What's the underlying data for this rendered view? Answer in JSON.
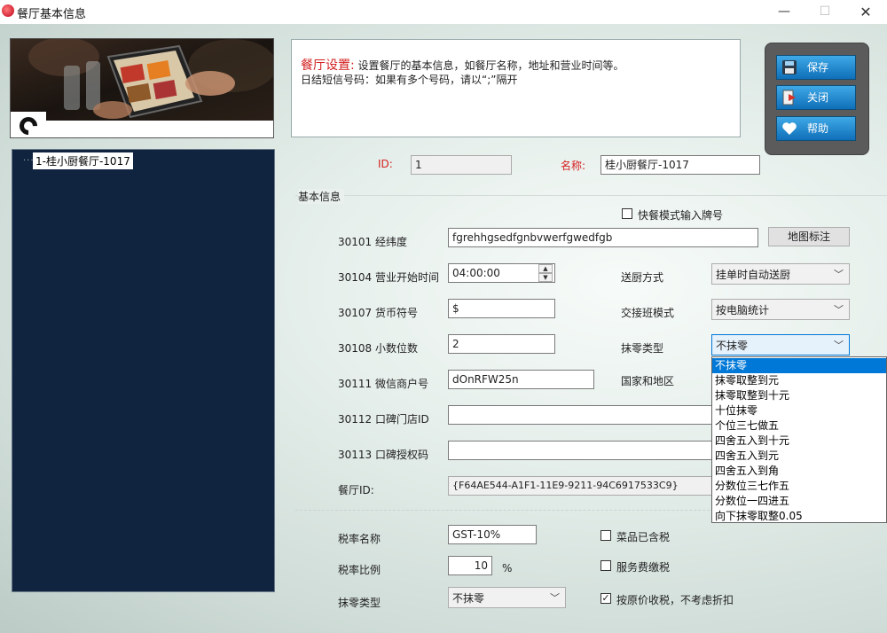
{
  "window": {
    "title": "餐厅基本信息"
  },
  "window_controls": {
    "minimize": "—",
    "maximize": "☐",
    "close": "✕"
  },
  "tree": {
    "dots": "···",
    "item": "1-桂小厨餐厅-1017"
  },
  "description": {
    "heading": "餐厅设置:",
    "line1": "设置餐厅的基本信息，如餐厅名称，地址和营业时间等。",
    "line2": "日结短信号码：如果有多个号码，请以“;”隔开"
  },
  "buttons": {
    "save": "保存",
    "close": "关闭",
    "help": "帮助"
  },
  "header_fields": {
    "id_label": "ID:",
    "id_value": "1",
    "name_label": "名称:",
    "name_value": "桂小厨餐厅-1017"
  },
  "group": {
    "title": "基本信息"
  },
  "fast_mode": {
    "label": "快餐模式输入牌号",
    "checked": false
  },
  "form": {
    "coords_label": "30101 经纬度",
    "coords_value": "fgrehhgsedfgnbvwerfgwedfgb",
    "map_button": "地图标注",
    "open_time_label": "30104 营业开始时间",
    "open_time_value": "04:00:00",
    "kitchen_label": "送厨方式",
    "kitchen_value": "挂单时自动送厨",
    "currency_label": "30107 货币符号",
    "currency_value": "$",
    "shift_label": "交接班模式",
    "shift_value": "按电脑统计",
    "decimals_label": "30108 小数位数",
    "decimals_value": "2",
    "rounding_label": "抹零类型",
    "rounding_value": "不抹零",
    "wechat_label": "30111 微信商户号",
    "wechat_value": "dOnRFW25n",
    "country_label": "国家和地区",
    "koubei_store_label": "30112 口碑门店ID",
    "koubei_store_value": "",
    "koubei_auth_label": "30113 口碑授权码",
    "koubei_auth_value": "",
    "restaurant_id_label": "餐厅ID:",
    "restaurant_id_value": "{F64AE544-A1F1-11E9-9211-94C6917533C9}"
  },
  "rounding_options": [
    "不抹零",
    "抹零取整到元",
    "抹零取整到十元",
    "十位抹零",
    "个位三七做五",
    "四舍五入到十元",
    "四舍五入到元",
    "四舍五入到角",
    "分数位三七作五",
    "分数位一四进五",
    "向下抹零取整0.05"
  ],
  "tax": {
    "name_label": "税率名称",
    "name_value": "GST-10%",
    "rate_label": "税率比例",
    "rate_value": "10",
    "rate_unit": "%",
    "rounding_label": "抹零类型",
    "rounding_value": "不抹零",
    "dish_tax_label": "菜品已含税",
    "dish_tax_checked": false,
    "service_tax_label": "服务费缴税",
    "service_tax_checked": false,
    "original_price_label": "按原价收税，不考虑折扣",
    "original_price_checked": true
  },
  "icons": {
    "save": "save-icon",
    "close": "exit-icon",
    "help": "heart-icon",
    "chevron": "chevron-down-icon"
  },
  "colors": {
    "accent_red": "#d32020",
    "button_blue": "#1a84cf",
    "tree_bg": "#10243f",
    "selection_blue": "#0078d7"
  }
}
